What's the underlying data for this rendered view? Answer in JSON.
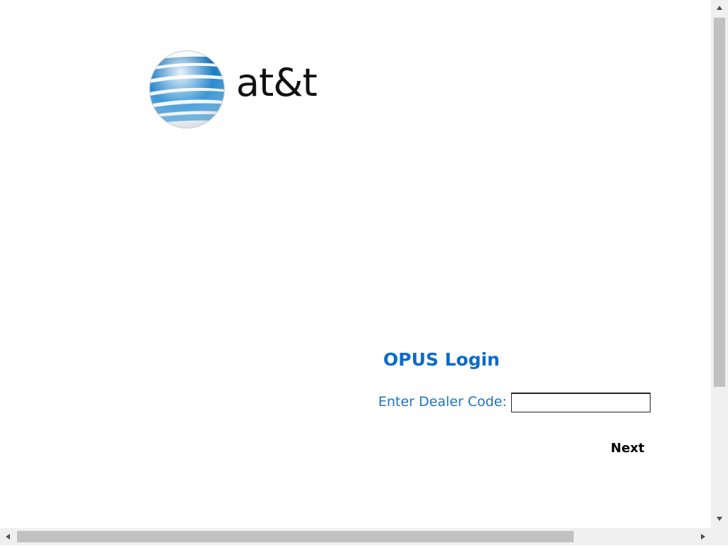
{
  "brand": {
    "logo_text": "at&t",
    "logo_icon": "att-globe-icon",
    "globe_colors": {
      "stripe_dark": "#0d6db5",
      "stripe_light": "#5fa9dd",
      "highlight": "#e8f2fa"
    }
  },
  "login": {
    "title": "OPUS Login",
    "dealer_code_label": "Enter Dealer Code:",
    "dealer_code_value": "",
    "next_button_label": "Next",
    "title_color": "#0b6bcb",
    "label_color": "#1a73c4"
  },
  "scrollbars": {
    "vertical_icons": [
      "chevron-up-icon",
      "chevron-down-icon"
    ],
    "horizontal_icons": [
      "chevron-left-icon",
      "chevron-right-icon"
    ]
  }
}
